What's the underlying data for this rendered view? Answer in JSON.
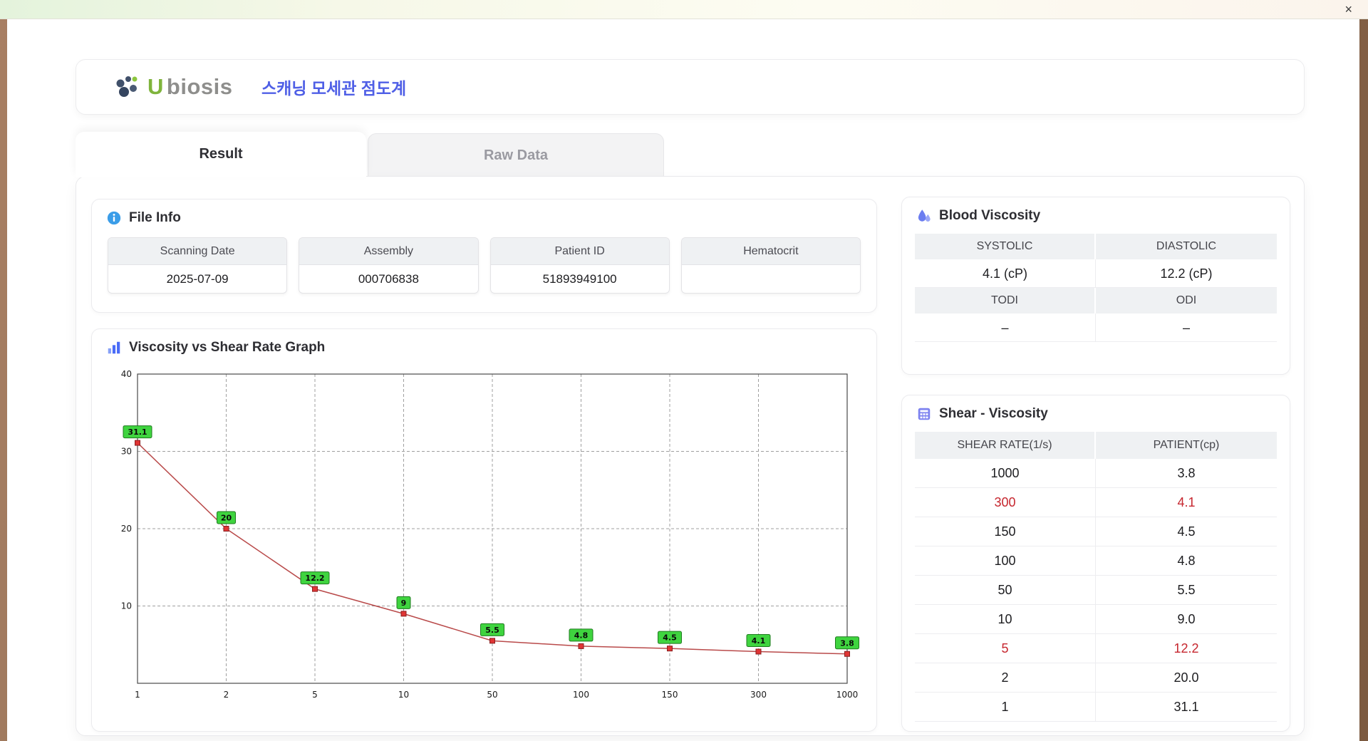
{
  "window": {
    "close_icon": "×"
  },
  "header": {
    "brand_leading": "U",
    "brand_rest": "biosis",
    "app_title": "스캐닝 모세관 점도계"
  },
  "tabs": {
    "result": {
      "label": "Result",
      "active": true
    },
    "raw_data": {
      "label": "Raw Data",
      "active": false
    }
  },
  "file_info": {
    "title": "File Info",
    "fields": [
      {
        "label": "Scanning Date",
        "value": "2025-07-09"
      },
      {
        "label": "Assembly",
        "value": "000706838"
      },
      {
        "label": "Patient ID",
        "value": "51893949100"
      },
      {
        "label": "Hematocrit",
        "value": ""
      }
    ]
  },
  "blood_viscosity": {
    "title": "Blood Viscosity",
    "metrics": [
      {
        "label": "SYSTOLIC",
        "value": "4.1 (cP)"
      },
      {
        "label": "DIASTOLIC",
        "value": "12.2 (cP)"
      },
      {
        "label": "TODI",
        "value": "–"
      },
      {
        "label": "ODI",
        "value": "–"
      }
    ]
  },
  "graph": {
    "title": "Viscosity vs Shear Rate Graph"
  },
  "chart_data": {
    "type": "line",
    "title": "Viscosity vs Shear Rate Graph",
    "x_categories": [
      "1",
      "2",
      "5",
      "10",
      "50",
      "100",
      "150",
      "300",
      "1000"
    ],
    "values": [
      31.1,
      20,
      12.2,
      9,
      5.5,
      4.8,
      4.5,
      4.1,
      3.8
    ],
    "point_labels": [
      "31.1",
      "20",
      "12.2",
      "9",
      "5.5",
      "4.8",
      "4.5",
      "4.1",
      "3.8"
    ],
    "xlabel": "",
    "ylabel": "",
    "ylim": [
      0,
      40
    ],
    "yticks": [
      10,
      20,
      30,
      40
    ],
    "x_scale": "categorical-evenly-spaced",
    "grid": "dashed",
    "legend": "none",
    "line_color": "#b94a4a",
    "marker_color": "#e03535",
    "marker_edge_color": "#8a1f1f",
    "point_label_bg": "#3fd43f",
    "point_label_border": "#1f7a1f"
  },
  "shear_table": {
    "title": "Shear - Viscosity",
    "columns": [
      "SHEAR RATE(1/s)",
      "PATIENT(cp)"
    ],
    "rows": [
      {
        "shear_rate": "1000",
        "patient": "3.8",
        "highlighted": false
      },
      {
        "shear_rate": "300",
        "patient": "4.1",
        "highlighted": true
      },
      {
        "shear_rate": "150",
        "patient": "4.5",
        "highlighted": false
      },
      {
        "shear_rate": "100",
        "patient": "4.8",
        "highlighted": false
      },
      {
        "shear_rate": "50",
        "patient": "5.5",
        "highlighted": false
      },
      {
        "shear_rate": "10",
        "patient": "9.0",
        "highlighted": false
      },
      {
        "shear_rate": "5",
        "patient": "12.2",
        "highlighted": true
      },
      {
        "shear_rate": "2",
        "patient": "20.0",
        "highlighted": false
      },
      {
        "shear_rate": "1",
        "patient": "31.1",
        "highlighted": false
      }
    ],
    "highlight_color": "#c6262e"
  },
  "colors": {
    "accent_blue": "#4f5fe6",
    "brand_green": "#7fb43c",
    "header_cell_bg": "#eff1f3",
    "card_border": "#ebebee"
  }
}
